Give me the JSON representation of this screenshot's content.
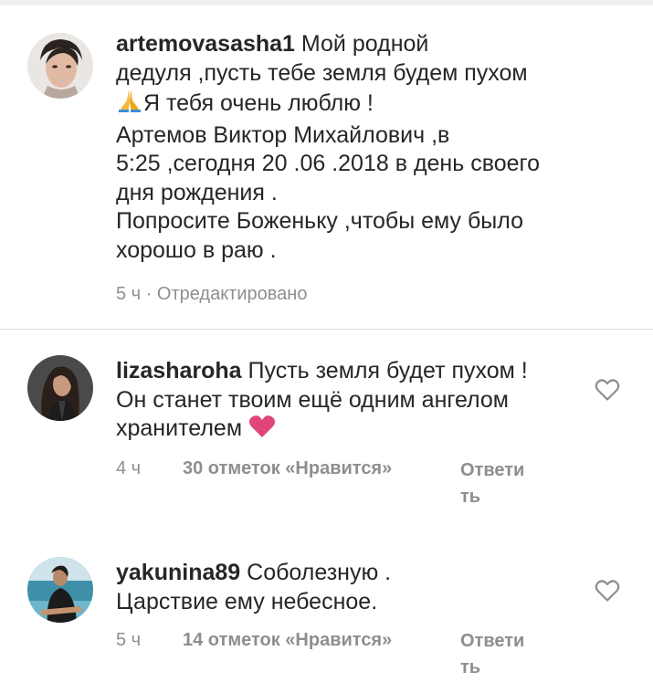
{
  "comments": [
    {
      "username": "artemovasasha1",
      "lines": [
        "Мой родной",
        "дедуля ,пусть тебе земля будем пухом",
        "Я тебя очень люблю !",
        "Артемов Виктор Михайлович ,в",
        "5:25 ,сегодня 20 .06 .2018 в день своего",
        "дня рождения .",
        "Попросите  Боженьку ,чтобы ему было",
        "хорошо в раю ."
      ],
      "emoji": "folded-hands",
      "time": "5 ч",
      "edited": "· Отредактировано"
    },
    {
      "username": "lizasharoha",
      "lines": [
        "Пусть земля будет пухом !",
        "Он станет твоим ещё одним ангелом",
        "хранителем"
      ],
      "emoji": "heart",
      "time": "4 ч",
      "likes": "30 отметок «Нравится»",
      "reply_line1": "Ответи",
      "reply_line2": "ть"
    },
    {
      "username": "yakunina89",
      "lines": [
        "Соболезную .",
        "Царствие ему небесное."
      ],
      "time": "5 ч",
      "likes": "14 отметок «Нравится»",
      "reply_line1": "Ответи",
      "reply_line2": "ть"
    }
  ],
  "colors": {
    "text": "#262626",
    "meta": "#8e8e8e",
    "heart_emoji": "#e0457b",
    "divider": "#dbdbdb"
  },
  "icons": [
    "heart-outline-icon",
    "folded-hands-emoji",
    "heart-emoji"
  ]
}
